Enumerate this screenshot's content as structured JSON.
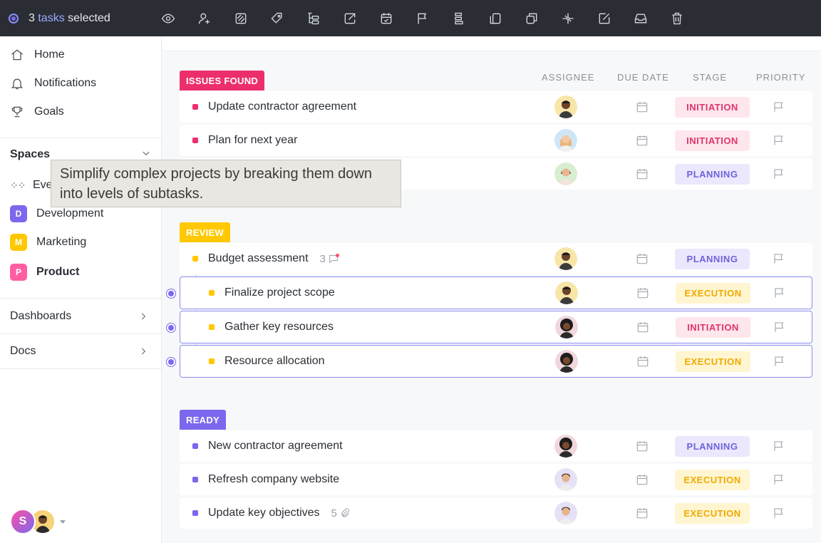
{
  "toolbar": {
    "selected_count": "3",
    "selected_word": "tasks",
    "selected_suffix": "selected",
    "tools": [
      "eye-icon",
      "assign-user-icon",
      "tag-icon",
      "label-icon",
      "subtask-tree-icon",
      "move-icon",
      "calendar-check-icon",
      "flag-icon",
      "priority-stack-icon",
      "duplicate-icon",
      "copy-icon",
      "dependency-icon",
      "edit-icon",
      "archive-icon",
      "trash-icon"
    ]
  },
  "sidebar": {
    "nav": [
      {
        "label": "Home",
        "icon": "home-icon"
      },
      {
        "label": "Notifications",
        "icon": "bell-icon"
      },
      {
        "label": "Goals",
        "icon": "trophy-icon"
      }
    ],
    "spaces_title": "Spaces",
    "everything_label": "Eve",
    "spaces": [
      {
        "letter": "D",
        "label": "Development",
        "color": "#7b68ee"
      },
      {
        "letter": "M",
        "label": "Marketing",
        "color": "#ffc800"
      },
      {
        "letter": "P",
        "label": "Product",
        "color": "#ff5fa2"
      }
    ],
    "dashboards": "Dashboards",
    "docs": "Docs",
    "user_initial": "S"
  },
  "tooltip": "Simplify complex projects by breaking them down into levels of subtasks.",
  "columns": {
    "assignee": "ASSIGNEE",
    "due_date": "DUE DATE",
    "stage": "STAGE",
    "priority": "PRIORITY"
  },
  "groups": [
    {
      "status": "ISSUES FOUND",
      "color": "#ec2f6b",
      "tasks": [
        {
          "name": "Update contractor agreement",
          "stage": "INITIATION"
        },
        {
          "name": "Plan for next year",
          "stage": "INITIATION"
        },
        {
          "name": "",
          "stage": "PLANNING"
        }
      ]
    },
    {
      "status": "REVIEW",
      "color": "#ffc800",
      "tasks": [
        {
          "name": "Budget assessment",
          "stage": "PLANNING",
          "comments": "3"
        },
        {
          "name": "Finalize project scope",
          "stage": "EXECUTION"
        },
        {
          "name": "Gather key resources",
          "stage": "INITIATION"
        },
        {
          "name": "Resource allocation",
          "stage": "EXECUTION"
        }
      ]
    },
    {
      "status": "READY",
      "color": "#7b68ee",
      "tasks": [
        {
          "name": "New contractor agreement",
          "stage": "PLANNING"
        },
        {
          "name": "Refresh company website",
          "stage": "EXECUTION"
        },
        {
          "name": "Update key objectives",
          "stage": "EXECUTION",
          "attachments": "5"
        }
      ]
    }
  ],
  "stage_colors": {
    "INITIATION": {
      "bg": "#fde6ec",
      "fg": "#e0336d"
    },
    "PLANNING": {
      "bg": "#ebe8fd",
      "fg": "#6e63d9"
    },
    "EXECUTION": {
      "bg": "#fff5d1",
      "fg": "#eeaa00"
    }
  }
}
